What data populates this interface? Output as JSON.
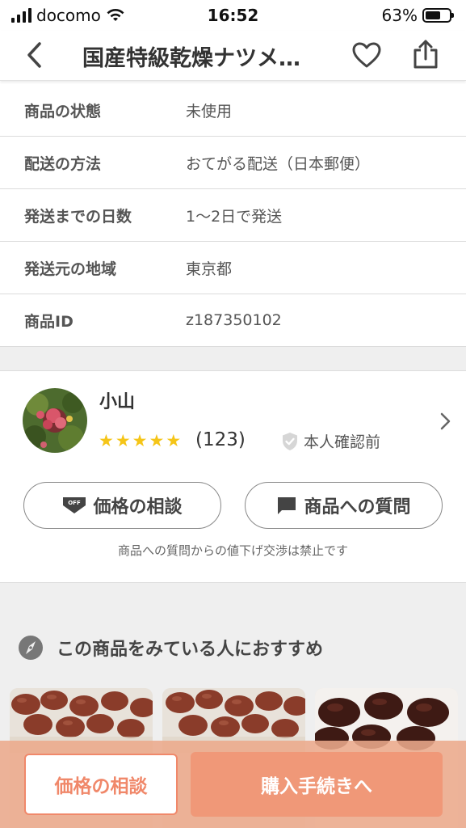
{
  "status_bar": {
    "carrier": "docomo",
    "time": "16:52",
    "battery": "63%",
    "battery_level": 0.63
  },
  "header": {
    "title": "国産特級乾燥ナツメ…",
    "icons": [
      "back-chevron-icon",
      "heart-icon",
      "share-icon"
    ]
  },
  "details": [
    {
      "label": "商品の状態",
      "value": "未使用"
    },
    {
      "label": "配送の方法",
      "value": "おてがる配送（日本郵便）"
    },
    {
      "label": "発送までの日数",
      "value": "1〜2日で発送"
    },
    {
      "label": "発送元の地域",
      "value": "東京都"
    },
    {
      "label": "商品ID",
      "value": "z187350102"
    }
  ],
  "seller": {
    "name": "小山",
    "stars": 5,
    "rating_count": "(123)",
    "verification": "本人確認前",
    "price_button": "価格の相談",
    "question_button": "商品への質問",
    "notice": "商品への質問からの値下げ交渉は禁止です"
  },
  "recommendations": {
    "title": "この商品をみている人におすすめ"
  },
  "bottom_bar": {
    "price_button": "価格の相談",
    "buy_button": "購入手続きへ"
  },
  "colors": {
    "accent": "#f09878",
    "accent_border": "#f0886a",
    "star": "#f5c518"
  }
}
